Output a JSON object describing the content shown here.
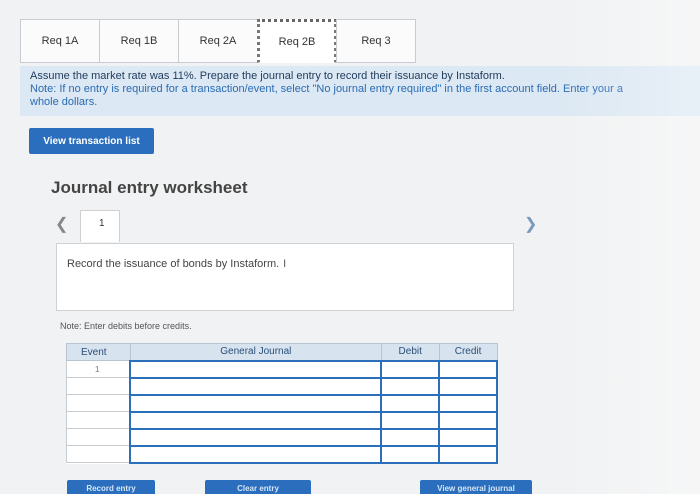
{
  "tabs": [
    {
      "label": "Req 1A",
      "active": false
    },
    {
      "label": "Req 1B",
      "active": false
    },
    {
      "label": "Req 2A",
      "active": false
    },
    {
      "label": "Req 2B",
      "active": true
    },
    {
      "label": "Req 3",
      "active": false
    }
  ],
  "instructions": {
    "line1": "Assume the market rate was 11%. Prepare the journal entry to record their issuance by Instaform.",
    "note_line": "Note: If no entry is required for a transaction/event, select \"No journal entry required\" in the first account field. Enter your a",
    "note_line2": "whole dollars."
  },
  "view_transaction_button": "View transaction list",
  "worksheet": {
    "title": "Journal entry worksheet",
    "page_number": "1",
    "description": "Record the issuance of bonds by Instaform.",
    "note_credits": "Note: Enter debits before credits."
  },
  "table": {
    "headers": [
      "Event",
      "General Journal",
      "Debit",
      "Credit"
    ],
    "first_event": "1"
  },
  "bottom_buttons": {
    "record_entry": "Record entry",
    "clear_entry": "Clear entry",
    "view_general_journal": "View general journal"
  },
  "colors": {
    "accent_blue": "#2a6ebd",
    "instruction_bg": "#dce8f3",
    "header_bg": "#d7e3ef"
  }
}
